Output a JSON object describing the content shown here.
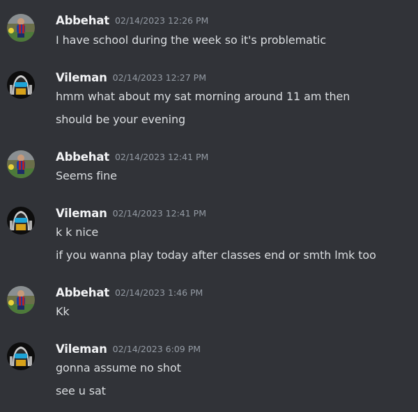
{
  "messages": [
    {
      "author": "Abbehat",
      "avatar_icon": "soccer-player-avatar-icon",
      "timestamp": "02/14/2023 12:26 PM",
      "lines": [
        "I have school during the week so it's problematic"
      ]
    },
    {
      "author": "Vileman",
      "avatar_icon": "robot-helmet-avatar-icon",
      "timestamp": "02/14/2023 12:27 PM",
      "lines": [
        "hmm what about my sat morning around 11 am then",
        "should be your evening"
      ]
    },
    {
      "author": "Abbehat",
      "avatar_icon": "soccer-player-avatar-icon",
      "timestamp": "02/14/2023 12:41 PM",
      "lines": [
        "Seems fine"
      ]
    },
    {
      "author": "Vileman",
      "avatar_icon": "robot-helmet-avatar-icon",
      "timestamp": "02/14/2023 12:41 PM",
      "lines": [
        "k k nice",
        "if you wanna play today after classes end or smth lmk too"
      ]
    },
    {
      "author": "Abbehat",
      "avatar_icon": "soccer-player-avatar-icon",
      "timestamp": "02/14/2023 1:46 PM",
      "lines": [
        "Kk"
      ]
    },
    {
      "author": "Vileman",
      "avatar_icon": "robot-helmet-avatar-icon",
      "timestamp": "02/14/2023 6:09 PM",
      "lines": [
        "gonna assume no shot",
        "see u sat"
      ]
    }
  ],
  "colors": {
    "background": "#313338",
    "username": "#f2f3f5",
    "timestamp": "#949ba4",
    "message_text": "#dbdee1"
  }
}
